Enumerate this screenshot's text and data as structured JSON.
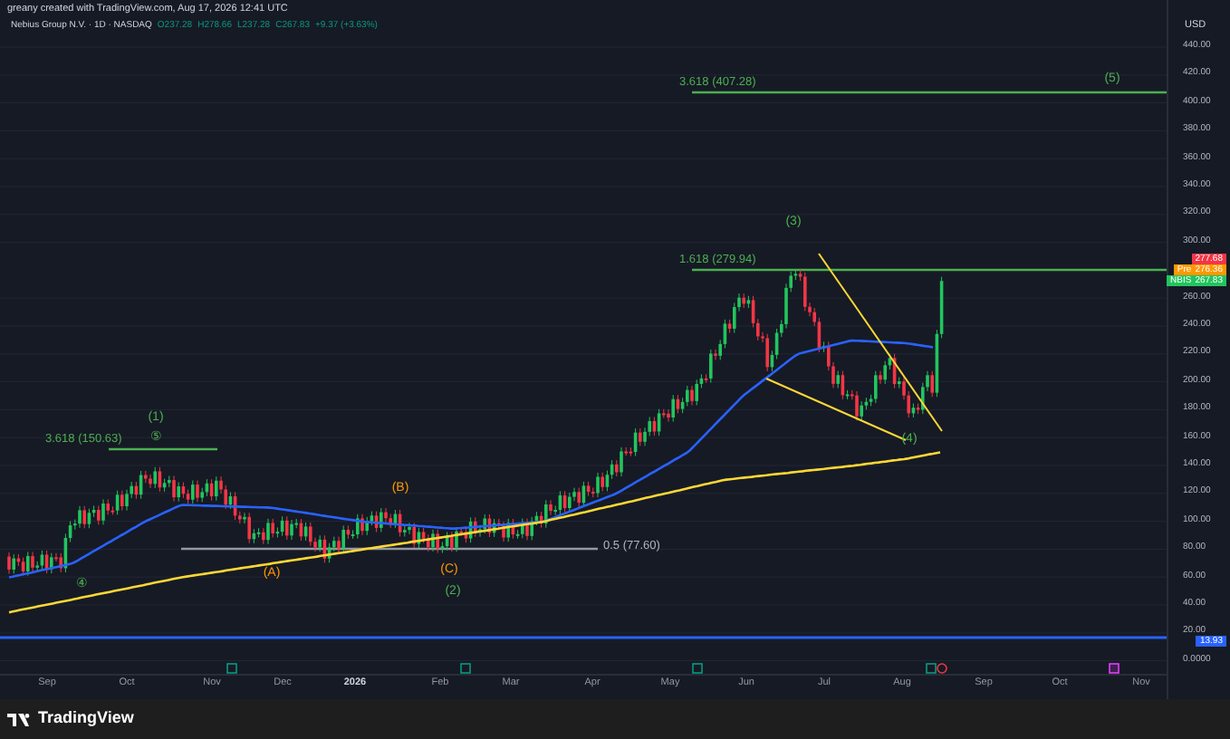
{
  "header": {
    "attribution": "greany created with TradingView.com, Aug 17, 2026 12:41 UTC",
    "symbol": "Nebius Group N.V. · 1D · NASDAQ",
    "ohlc": [
      "O237.28",
      "H278.66",
      "L237.28",
      "C267.83",
      "+9.37 (+3.63%)"
    ]
  },
  "annotations": [
    {
      "text": "3.618 (407.28)",
      "color": "#4caf50"
    },
    {
      "text": "(5)",
      "color": "#4caf50"
    },
    {
      "text": "(3)",
      "color": "#4caf50"
    },
    {
      "text": "1.618 (279.94)",
      "color": "#4caf50"
    },
    {
      "text": "(1)",
      "color": "#4caf50"
    },
    {
      "text": "3.618 (150.63)",
      "color": "#4caf50"
    },
    {
      "text": "⑤",
      "color": "#4caf50"
    },
    {
      "text": "(4)",
      "color": "#4caf50"
    },
    {
      "text": "(B)",
      "color": "#ff9800"
    },
    {
      "text": "0.5 (77.60)",
      "color": "#b2b5be"
    },
    {
      "text": "(A)",
      "color": "#ff9800"
    },
    {
      "text": "(C)",
      "color": "#ff9800"
    },
    {
      "text": "④",
      "color": "#4caf50"
    },
    {
      "text": "(2)",
      "color": "#4caf50"
    }
  ],
  "price_axis": {
    "currency": "USD",
    "labels": [
      "440.00",
      "420.00",
      "400.00",
      "380.00",
      "360.00",
      "340.00",
      "320.00",
      "300.00",
      "260.00",
      "240.00",
      "220.00",
      "200.00",
      "180.00",
      "160.00",
      "140.00",
      "120.00",
      "100.00",
      "80.00",
      "60.00",
      "40.00",
      "20.00",
      "0.0000"
    ]
  },
  "price_tags": [
    {
      "value": "277.68",
      "color": "#f23645"
    },
    {
      "label": "Pre",
      "value": "276.36",
      "color": "#ff9800"
    },
    {
      "label": "NBIS",
      "value": "267.83",
      "color": "#22c55e"
    },
    {
      "value": "13.93",
      "color": "#2962ff"
    }
  ],
  "time_axis": {
    "labels": [
      "Sep",
      "Oct",
      "Nov",
      "Dec",
      "2026",
      "Feb",
      "Mar",
      "Apr",
      "May",
      "Jun",
      "Jul",
      "Aug",
      "Sep",
      "Oct",
      "Nov"
    ]
  },
  "footer": {
    "logo_text": "TradingView"
  }
}
